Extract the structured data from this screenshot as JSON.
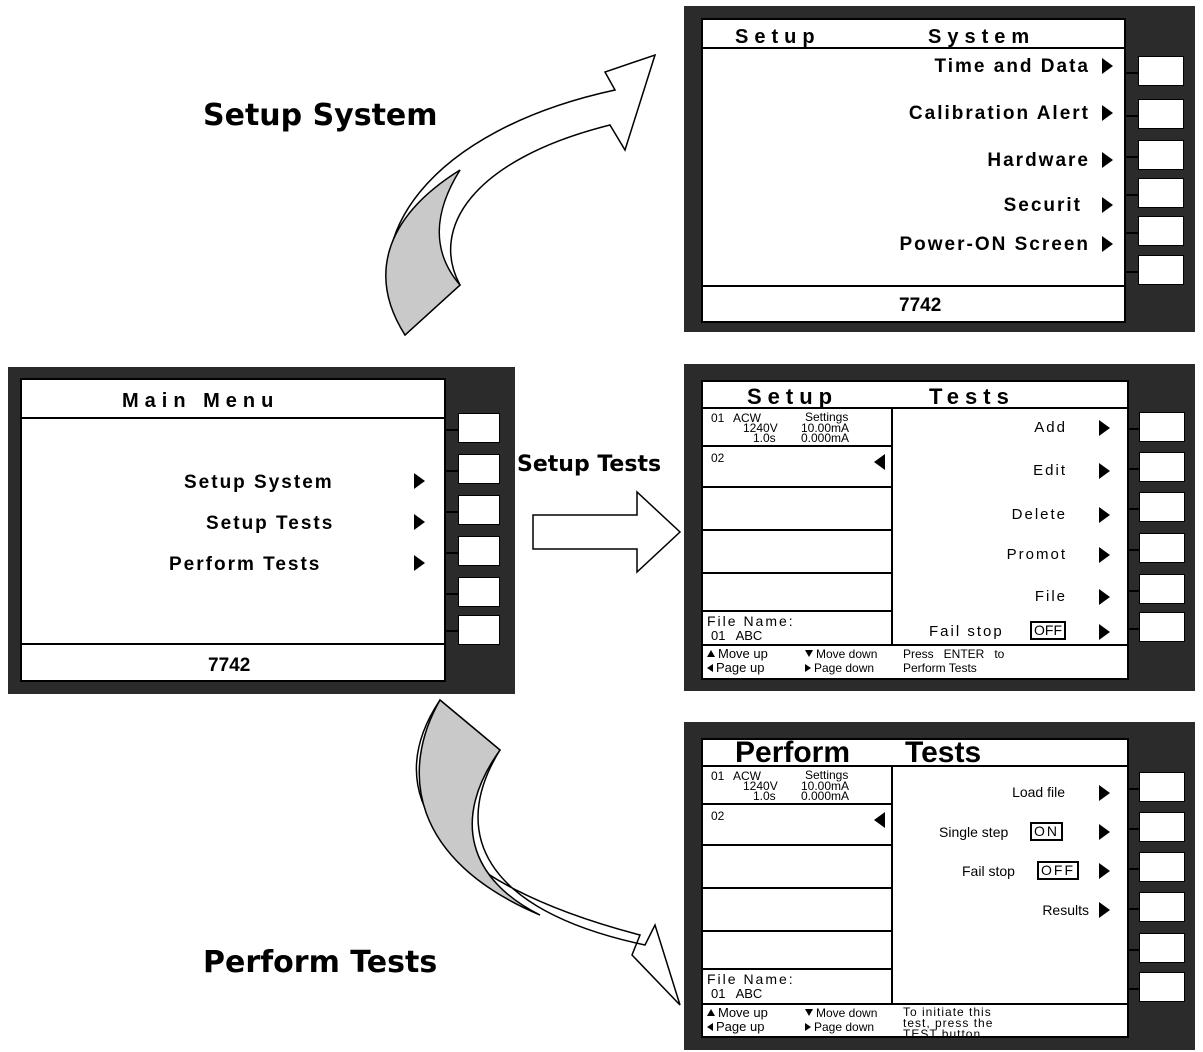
{
  "labels": {
    "setup_system": "Setup System",
    "setup_tests": "Setup Tests",
    "perform_tests": "Perform Tests"
  },
  "main_menu": {
    "title": "Main Menu",
    "items": [
      "Setup System",
      "Setup Tests",
      "Perform Tests"
    ],
    "footer": "7742"
  },
  "setup_system": {
    "title_left": "Setup",
    "title_right": "System",
    "items": [
      "Time and Data",
      "Calibration Alert",
      "Hardware",
      "Securit",
      "Power-ON Screen"
    ],
    "footer": "7742"
  },
  "setup_tests": {
    "title_left": "Setup",
    "title_right": "Tests",
    "step1": {
      "num": "01",
      "type": "ACW",
      "label": "Settings",
      "voltage": "1240V",
      "current": "10.00mA",
      "time": "1.0s",
      "low": "0.000mA"
    },
    "step2": {
      "num": "02"
    },
    "file_label": "File Name:",
    "file_value": "01   ABC",
    "items": [
      "Add",
      "Edit",
      "Delete",
      "Promot",
      "File"
    ],
    "failstop_label": "Fail stop",
    "failstop_value": "OFF",
    "help_move_up": "Move up",
    "help_page_up": "Page up",
    "help_move_down": "Move down",
    "help_page_down": "Page down",
    "help_line1": "Press   ENTER   to",
    "help_line2": "Perform Tests"
  },
  "perform_tests": {
    "title_left": "Perform",
    "title_right": "Tests",
    "step1": {
      "num": "01",
      "type": "ACW",
      "label": "Settings",
      "voltage": "1240V",
      "current": "10.00mA",
      "time": "1.0s",
      "low": "0.000mA"
    },
    "step2": {
      "num": "02"
    },
    "file_label": "File Name:",
    "file_value": "01   ABC",
    "load_file": "Load file",
    "single_step_label": "Single step",
    "single_step_value": "ON",
    "failstop_label": "Fail stop",
    "failstop_value": "OFF",
    "results": "Results",
    "help_move_up": "Move up",
    "help_page_up": "Page up",
    "help_move_down": "Move down",
    "help_page_down": "Page down",
    "help_line1": "To initiate this",
    "help_line2": "test, press the",
    "help_line3": "TEST button"
  }
}
